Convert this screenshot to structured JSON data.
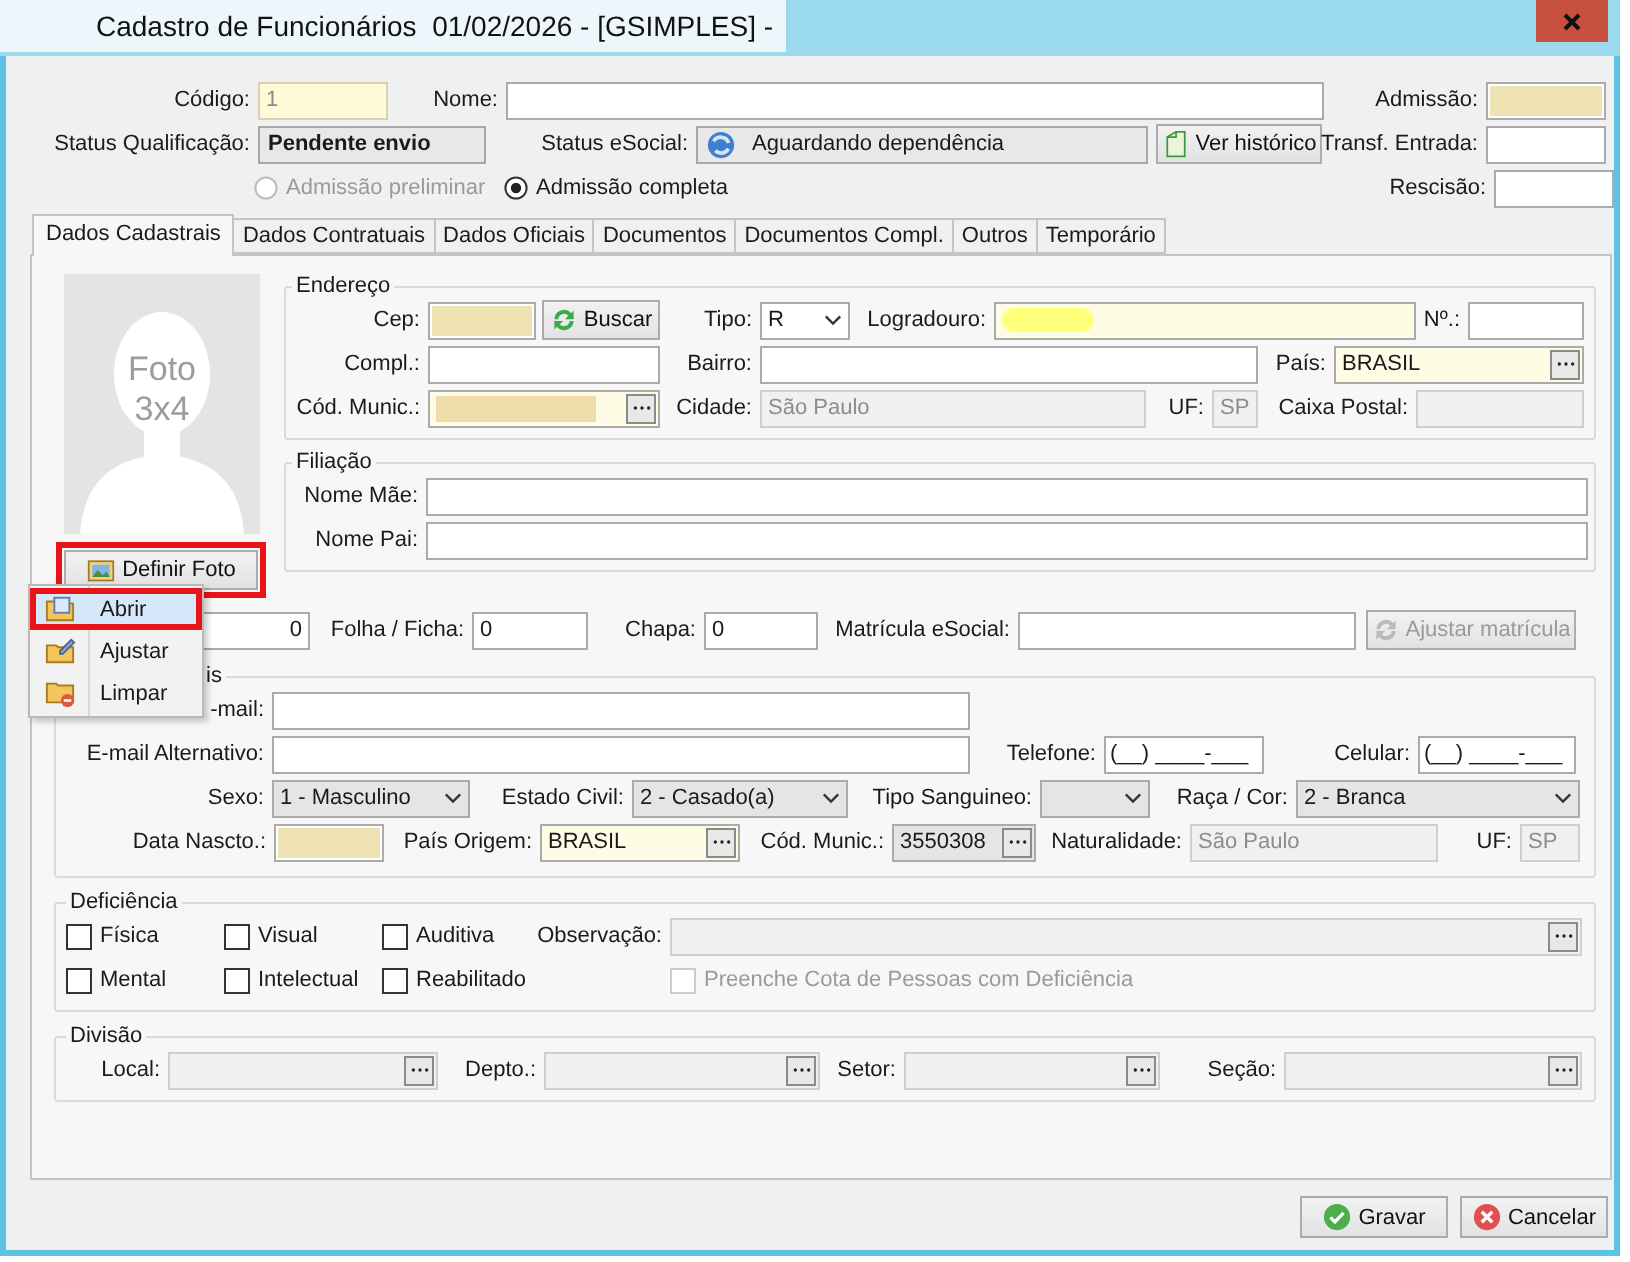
{
  "window": {
    "title": "Cadastro de Funcionários  01/02/2026 - [GSIMPLES] -"
  },
  "header": {
    "fields": [
      {
        "kind": "text",
        "label": "Código:",
        "value": "1",
        "required": true,
        "disabled": true
      },
      {
        "kind": "text",
        "label": "Nome:"
      },
      {
        "kind": "text",
        "label": "Admissão:",
        "redacted": true
      },
      {
        "kind": "status",
        "label": "Status Qualificação:",
        "value": "Pendente envio"
      },
      {
        "kind": "status_icon",
        "label": "Status eSocial:",
        "value": "Aguardando dependência"
      },
      {
        "kind": "button",
        "label": "Ver histórico"
      },
      {
        "kind": "text",
        "label": "Transf. Entrada:"
      },
      {
        "kind": "radio",
        "label": "Admissão preliminar",
        "selected": false,
        "disabled": true
      },
      {
        "kind": "radio",
        "label": "Admissão completa",
        "selected": true,
        "disabled": false
      },
      {
        "kind": "text",
        "label": "Rescisão:"
      }
    ]
  },
  "tabs": [
    {
      "label": "Dados Cadastrais",
      "selected": true
    },
    {
      "label": "Dados Contratuais",
      "selected": false
    },
    {
      "label": "Dados Oficiais",
      "selected": false
    },
    {
      "label": "Documentos",
      "selected": false
    },
    {
      "label": "Documentos Compl.",
      "selected": false
    },
    {
      "label": "Outros",
      "selected": false
    },
    {
      "label": "Temporário",
      "selected": false
    }
  ],
  "photo": {
    "caption": "Foto 3x4",
    "button": {
      "label": "Definir Foto",
      "annotated": true
    }
  },
  "endereco": {
    "title": "Endereço",
    "fields": [
      {
        "kind": "text",
        "label": "Cep:",
        "redacted": true
      },
      {
        "kind": "button",
        "label": "Buscar"
      },
      {
        "kind": "select",
        "label": "Tipo:",
        "value": "R"
      },
      {
        "kind": "text",
        "label": "Logradouro:",
        "required": true,
        "redacted": true
      },
      {
        "kind": "text",
        "label": "Nº.:"
      },
      {
        "kind": "text",
        "label": "Compl.:"
      },
      {
        "kind": "text",
        "label": "Bairro:"
      },
      {
        "kind": "lookup",
        "label": "País:",
        "value": "BRASIL",
        "required": true
      },
      {
        "kind": "lookup",
        "label": "Cód. Munic.:",
        "required": true,
        "redacted": true
      },
      {
        "kind": "text",
        "label": "Cidade:",
        "value": "São Paulo",
        "disabled": true
      },
      {
        "kind": "text",
        "label": "UF:",
        "value": "SP",
        "disabled": true
      },
      {
        "kind": "text",
        "label": "Caixa Postal:",
        "disabled": true
      }
    ]
  },
  "filiacao": {
    "title": "Filiação",
    "fields": [
      {
        "kind": "text",
        "label": "Nome Mãe:"
      },
      {
        "kind": "text",
        "label": "Nome Pai:"
      }
    ]
  },
  "registro": {
    "fields": [
      {
        "kind": "text",
        "value": "0"
      },
      {
        "kind": "text",
        "label": "Folha / Ficha:",
        "value": "0"
      },
      {
        "kind": "text",
        "label": "Chapa:",
        "value": "0"
      },
      {
        "kind": "text",
        "label": "Matrícula eSocial:"
      },
      {
        "kind": "button",
        "label": "Ajustar matrícula",
        "disabled": true
      }
    ]
  },
  "pessoais": {
    "title": "is",
    "fields": [
      {
        "kind": "text",
        "label": "-mail:"
      },
      {
        "kind": "text",
        "label": "E-mail Alternativo:"
      },
      {
        "kind": "text",
        "label": "Telefone:",
        "value": "(__) ____-___"
      },
      {
        "kind": "text",
        "label": "Celular:",
        "value": "(__) ____-___"
      },
      {
        "kind": "select",
        "label": "Sexo:",
        "value": "1 - Masculino",
        "readonly": true
      },
      {
        "kind": "select",
        "label": "Estado Civil:",
        "value": "2 - Casado(a)",
        "readonly": true
      },
      {
        "kind": "select",
        "label": "Tipo Sanguineo:",
        "readonly": true
      },
      {
        "kind": "select",
        "label": "Raça / Cor:",
        "value": "2 - Branca",
        "readonly": true
      },
      {
        "kind": "text",
        "label": "Data Nascto.:",
        "redacted": true
      },
      {
        "kind": "lookup",
        "label": "País Origem:",
        "value": "BRASIL",
        "required": true
      },
      {
        "kind": "lookup",
        "label": "Cód. Munic.:",
        "value": "3550308",
        "readonly": true
      },
      {
        "kind": "text",
        "label": "Naturalidade:",
        "value": "São Paulo",
        "disabled": true
      },
      {
        "kind": "text",
        "label": "UF:",
        "value": "SP",
        "disabled": true
      }
    ]
  },
  "deficiencia": {
    "title": "Deficiência",
    "checkboxes": [
      {
        "label": "Física",
        "checked": false
      },
      {
        "label": "Visual",
        "checked": false
      },
      {
        "label": "Auditiva",
        "checked": false
      },
      {
        "label": "Mental",
        "checked": false
      },
      {
        "label": "Intelectual",
        "checked": false
      },
      {
        "label": "Reabilitado",
        "checked": false
      }
    ],
    "observacao": {
      "kind": "lookup",
      "label": "Observação:",
      "disabled": true
    },
    "cota": {
      "label": "Preenche Cota de Pessoas com Deficiência",
      "checked": false,
      "disabled": true
    }
  },
  "divisao": {
    "title": "Divisão",
    "fields": [
      {
        "kind": "lookup",
        "label": "Local:",
        "disabled": true
      },
      {
        "kind": "lookup",
        "label": "Depto.:",
        "disabled": true
      },
      {
        "kind": "lookup",
        "label": "Setor:",
        "disabled": true
      },
      {
        "kind": "lookup",
        "label": "Seção:",
        "disabled": true
      }
    ]
  },
  "actions": [
    {
      "label": "Gravar"
    },
    {
      "label": "Cancelar"
    }
  ],
  "context_menu": {
    "items": [
      {
        "label": "Abrir",
        "selected": true,
        "annotated": true
      },
      {
        "label": "Ajustar",
        "selected": false,
        "annotated": false
      },
      {
        "label": "Limpar",
        "selected": false,
        "annotated": false
      }
    ]
  }
}
